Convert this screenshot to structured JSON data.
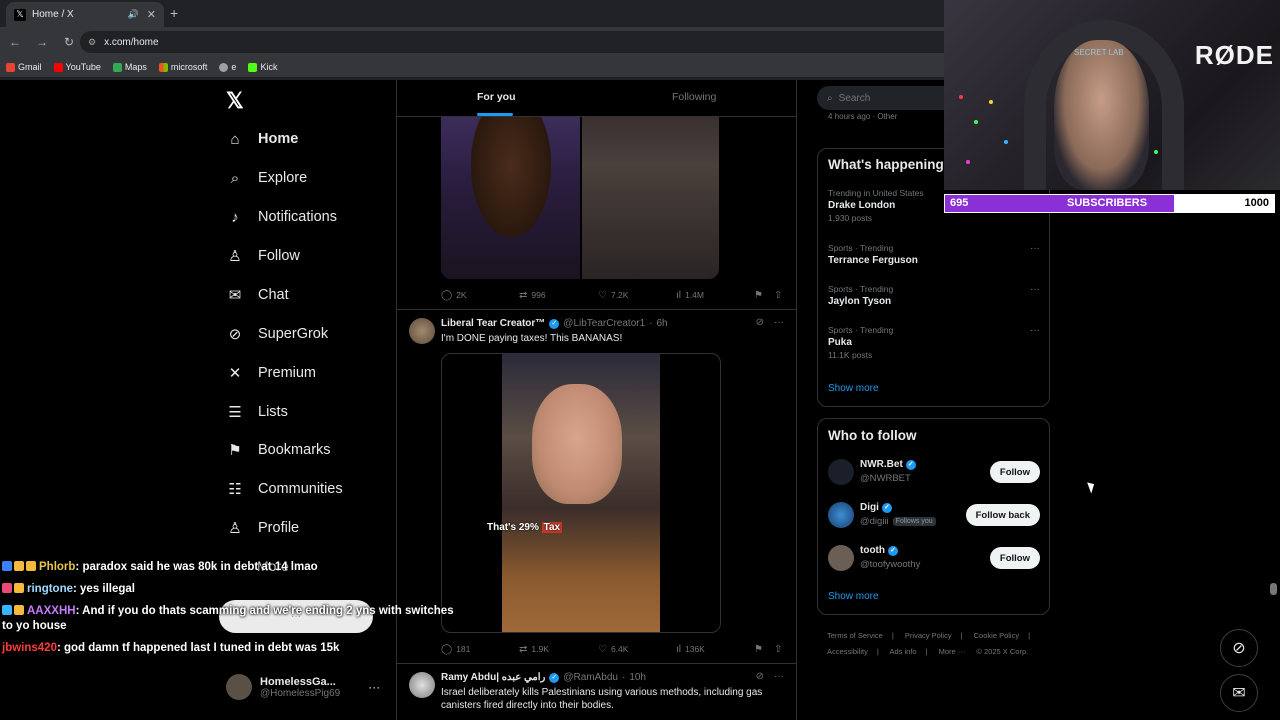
{
  "browser": {
    "tab_title": "Home / X",
    "url": "x.com/home",
    "bookmarks": [
      "Gmail",
      "YouTube",
      "Maps",
      "microsoft",
      "e",
      "Kick"
    ]
  },
  "nav": {
    "items": [
      "Home",
      "Explore",
      "Notifications",
      "Follow",
      "Chat",
      "SuperGrok",
      "Premium",
      "Lists",
      "Bookmarks",
      "Communities",
      "Profile",
      "More"
    ]
  },
  "account": {
    "name": "HomelessGa...",
    "handle": "@HomelessPig69"
  },
  "feed": {
    "tabs": {
      "for_you": "For you",
      "following": "Following"
    },
    "tweet1_stats": {
      "replies": "2K",
      "reposts": "996",
      "likes": "7.2K",
      "views": "1.4M"
    },
    "tweet2": {
      "name": "Liberal Tear Creator™",
      "handle": "@LibTearCreator1",
      "time": "6h",
      "text": "I'm DONE paying taxes! This BANANAS!",
      "caption_a": "That's 29%",
      "caption_b": "Tax",
      "stats": {
        "replies": "181",
        "reposts": "1.9K",
        "likes": "6.4K",
        "views": "136K"
      }
    },
    "tweet3": {
      "name": "Ramy Abdu| رامي عبده",
      "handle": "@RamAbdu",
      "time": "10h",
      "text": "Israel deliberately kills Palestinians using various methods, including gas canisters fired directly into their bodies."
    }
  },
  "right": {
    "search_placeholder": "Search",
    "top_snippet": "4 hours ago · Other",
    "happening": {
      "title": "What's happening",
      "trends": [
        {
          "meta": "Trending in United States",
          "title": "Drake London",
          "posts": "1,930 posts"
        },
        {
          "meta": "Sports · Trending",
          "title": "Terrance Ferguson",
          "posts": ""
        },
        {
          "meta": "Sports · Trending",
          "title": "Jaylon Tyson",
          "posts": ""
        },
        {
          "meta": "Sports · Trending",
          "title": "Puka",
          "posts": "11.1K posts"
        }
      ],
      "show_more": "Show more"
    },
    "who_to_follow": {
      "title": "Who to follow",
      "accounts": [
        {
          "name": "NWR.Bet",
          "handle": "@NWRBET",
          "button": "Follow",
          "follows_you": ""
        },
        {
          "name": "Digi",
          "handle": "@digiii",
          "button": "Follow back",
          "follows_you": "Follows you"
        },
        {
          "name": "tooth",
          "handle": "@toofywoothy",
          "button": "Follow",
          "follows_you": ""
        }
      ],
      "show_more": "Show more"
    },
    "footer": [
      "Terms of Service",
      "|",
      "Privacy Policy",
      "|",
      "Cookie Policy",
      "|",
      "Accessibility",
      "|",
      "Ads info",
      "|",
      "More ···",
      "© 2025 X Corp."
    ]
  },
  "stream": {
    "rode_text": "RØDE",
    "chair_brand": "SECRET LAB",
    "subs_current": "695",
    "subs_label": "SUBSCRIBERS",
    "subs_goal": "1000",
    "subs_progress": 0.695,
    "chat": [
      {
        "user": "Phlorb",
        "color": "#e8c64a",
        "msg": ": paradox said he was 80k in debt at 14 lmao"
      },
      {
        "user": "ringtone",
        "color": "#9fd8ff",
        "msg": ": yes illegal"
      },
      {
        "user": "AAXXHH",
        "color": "#c77dff",
        "msg": ": And if you do thats scamming and we're ending 2 yns with switches to yo house"
      },
      {
        "user": "jbwins420",
        "color": "#ff3b3b",
        "msg": ": god damn tf happened last I tuned in debt was 15k"
      }
    ]
  },
  "colors": {
    "accent": "#1d9bf0",
    "sub_bar": "#8b2fd6",
    "bg": "#000000"
  }
}
